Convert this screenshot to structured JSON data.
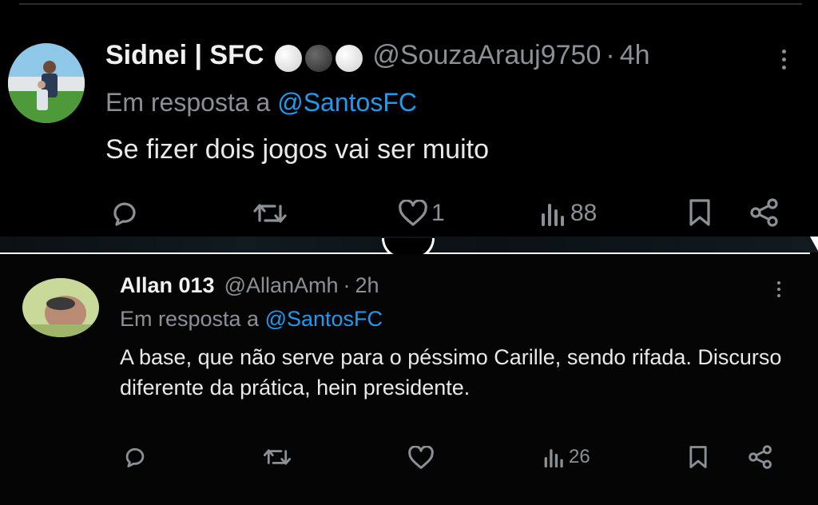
{
  "tweets": [
    {
      "name": "Sidnei | SFC",
      "handle": "@SouzaArauj9750",
      "separator": "·",
      "time": "4h",
      "badges": [
        "#f2f2f2",
        "#444444",
        "#f2f2f2"
      ],
      "reply_prefix": "Em resposta a",
      "reply_mention": "@SantosFC",
      "text": "Se fizer dois jogos vai ser muito",
      "actions": {
        "replies": "",
        "reposts": "",
        "likes": "1",
        "views": "88"
      }
    },
    {
      "name": "Allan 013",
      "handle": "@AllanAmh",
      "separator": "·",
      "time": "2h",
      "reply_prefix": "Em resposta a",
      "reply_mention": "@SantosFC",
      "text": "A base, que não serve para o péssimo Carille, sendo rifada. Discurso diferente da prática, hein presidente.",
      "actions": {
        "replies": "",
        "reposts": "",
        "likes": "",
        "views": "26"
      }
    }
  ],
  "icons": {
    "reply": "reply-icon",
    "repost": "repost-icon",
    "like": "heart-icon",
    "views": "views-icon",
    "bookmark": "bookmark-icon",
    "share": "share-icon",
    "more": "more-icon"
  },
  "colors": {
    "background": "#000000",
    "text": "#e7e9ea",
    "secondary": "#8b9096",
    "mention": "#1d9bf0"
  }
}
